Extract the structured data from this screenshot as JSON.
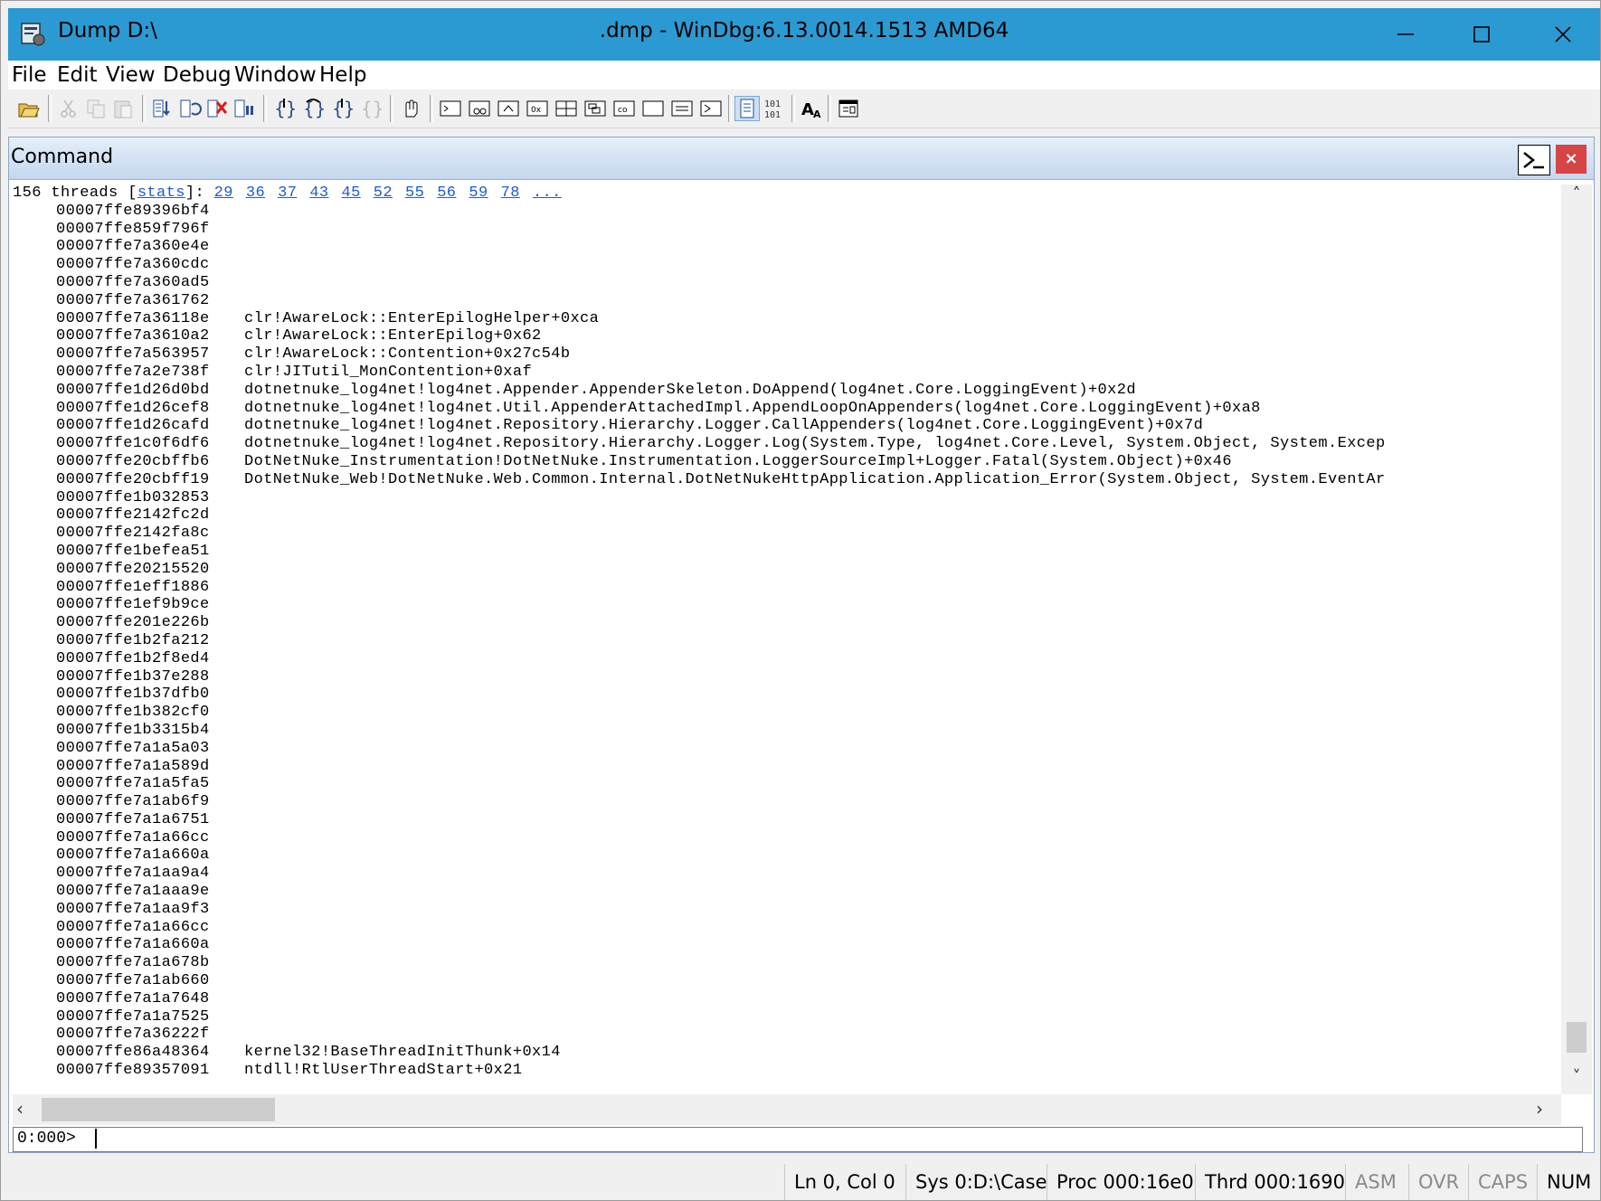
{
  "window": {
    "title_left": "Dump D:\\",
    "title_main": ".dmp - WinDbg:6.13.0014.1513 AMD64"
  },
  "menu": [
    "File",
    "Edit",
    "View",
    "Debug",
    "Window",
    "Help"
  ],
  "command_pane": {
    "title": "Command",
    "close_label": "×"
  },
  "output": {
    "header_prefix": "156 threads [",
    "header_stats": "stats",
    "header_suffix": "]:",
    "thread_links": [
      "29",
      "36",
      "37",
      "43",
      "45",
      "52",
      "55",
      "56",
      "59",
      "78",
      "..."
    ],
    "frames": [
      {
        "addr": "00007ffe89396bf4",
        "sym": ""
      },
      {
        "addr": "00007ffe859f796f",
        "sym": ""
      },
      {
        "addr": "00007ffe7a360e4e",
        "sym": ""
      },
      {
        "addr": "00007ffe7a360cdc",
        "sym": ""
      },
      {
        "addr": "00007ffe7a360ad5",
        "sym": ""
      },
      {
        "addr": "00007ffe7a361762",
        "sym": ""
      },
      {
        "addr": "00007ffe7a36118e",
        "sym": "clr!AwareLock::EnterEpilogHelper+0xca"
      },
      {
        "addr": "00007ffe7a3610a2",
        "sym": "clr!AwareLock::EnterEpilog+0x62"
      },
      {
        "addr": "00007ffe7a563957",
        "sym": "clr!AwareLock::Contention+0x27c54b"
      },
      {
        "addr": "00007ffe7a2e738f",
        "sym": "clr!JITutil_MonContention+0xaf"
      },
      {
        "addr": "00007ffe1d26d0bd",
        "sym": "dotnetnuke_log4net!log4net.Appender.AppenderSkeleton.DoAppend(log4net.Core.LoggingEvent)+0x2d"
      },
      {
        "addr": "00007ffe1d26cef8",
        "sym": "dotnetnuke_log4net!log4net.Util.AppenderAttachedImpl.AppendLoopOnAppenders(log4net.Core.LoggingEvent)+0xa8"
      },
      {
        "addr": "00007ffe1d26cafd",
        "sym": "dotnetnuke_log4net!log4net.Repository.Hierarchy.Logger.CallAppenders(log4net.Core.LoggingEvent)+0x7d"
      },
      {
        "addr": "00007ffe1c0f6df6",
        "sym": "dotnetnuke_log4net!log4net.Repository.Hierarchy.Logger.Log(System.Type, log4net.Core.Level, System.Object, System.Excep"
      },
      {
        "addr": "00007ffe20cbffb6",
        "sym": "DotNetNuke_Instrumentation!DotNetNuke.Instrumentation.LoggerSourceImpl+Logger.Fatal(System.Object)+0x46"
      },
      {
        "addr": "00007ffe20cbff19",
        "sym": "DotNetNuke_Web!DotNetNuke.Web.Common.Internal.DotNetNukeHttpApplication.Application_Error(System.Object, System.EventAr"
      },
      {
        "addr": "00007ffe1b032853",
        "sym": ""
      },
      {
        "addr": "00007ffe2142fc2d",
        "sym": ""
      },
      {
        "addr": "00007ffe2142fa8c",
        "sym": ""
      },
      {
        "addr": "00007ffe1befea51",
        "sym": ""
      },
      {
        "addr": "00007ffe20215520",
        "sym": ""
      },
      {
        "addr": "00007ffe1eff1886",
        "sym": ""
      },
      {
        "addr": "00007ffe1ef9b9ce",
        "sym": ""
      },
      {
        "addr": "00007ffe201e226b",
        "sym": ""
      },
      {
        "addr": "00007ffe1b2fa212",
        "sym": ""
      },
      {
        "addr": "00007ffe1b2f8ed4",
        "sym": ""
      },
      {
        "addr": "00007ffe1b37e288",
        "sym": ""
      },
      {
        "addr": "00007ffe1b37dfb0",
        "sym": ""
      },
      {
        "addr": "00007ffe1b382cf0",
        "sym": ""
      },
      {
        "addr": "00007ffe1b3315b4",
        "sym": ""
      },
      {
        "addr": "00007ffe7a1a5a03",
        "sym": ""
      },
      {
        "addr": "00007ffe7a1a589d",
        "sym": ""
      },
      {
        "addr": "00007ffe7a1a5fa5",
        "sym": ""
      },
      {
        "addr": "00007ffe7a1ab6f9",
        "sym": ""
      },
      {
        "addr": "00007ffe7a1a6751",
        "sym": ""
      },
      {
        "addr": "00007ffe7a1a66cc",
        "sym": ""
      },
      {
        "addr": "00007ffe7a1a660a",
        "sym": ""
      },
      {
        "addr": "00007ffe7a1aa9a4",
        "sym": ""
      },
      {
        "addr": "00007ffe7a1aaa9e",
        "sym": ""
      },
      {
        "addr": "00007ffe7a1aa9f3",
        "sym": ""
      },
      {
        "addr": "00007ffe7a1a66cc",
        "sym": ""
      },
      {
        "addr": "00007ffe7a1a660a",
        "sym": ""
      },
      {
        "addr": "00007ffe7a1a678b",
        "sym": ""
      },
      {
        "addr": "00007ffe7a1ab660",
        "sym": ""
      },
      {
        "addr": "00007ffe7a1a7648",
        "sym": ""
      },
      {
        "addr": "00007ffe7a1a7525",
        "sym": ""
      },
      {
        "addr": "00007ffe7a36222f",
        "sym": ""
      },
      {
        "addr": "00007ffe86a48364",
        "sym": "kernel32!BaseThreadInitThunk+0x14"
      },
      {
        "addr": "00007ffe89357091",
        "sym": "ntdll!RtlUserThreadStart+0x21"
      }
    ]
  },
  "command_line": {
    "prompt": "0:000>",
    "value": ""
  },
  "status": {
    "ln_col": "Ln 0, Col 0",
    "sys": "Sys 0:D:\\Case",
    "proc": "Proc 000:16e0",
    "thrd": "Thrd 000:1690",
    "asm": "ASM",
    "ovr": "OVR",
    "caps": "CAPS",
    "num": "NUM"
  },
  "icons": {
    "toolbar": [
      "open-icon",
      "cut-icon",
      "copy-icon",
      "paste-icon",
      "go-icon",
      "restart-icon",
      "stop-debugging-icon",
      "break-icon",
      "step-into-icon",
      "step-over-icon",
      "step-out-icon",
      "run-to-cursor-icon",
      "source-mode-icon",
      "command-window-icon",
      "watch-window-icon",
      "locals-window-icon",
      "registers-window-icon",
      "memory-window-icon",
      "call-stack-icon",
      "disassembly-icon",
      "scratch-pad-icon",
      "processes-threads-icon",
      "source-window-icon",
      "source-mode-toggle-icon",
      "hex-display-icon",
      "font-icon",
      "options-icon"
    ]
  },
  "colors": {
    "titlebar": "#2b9ad3",
    "link": "#1a5bd6"
  }
}
